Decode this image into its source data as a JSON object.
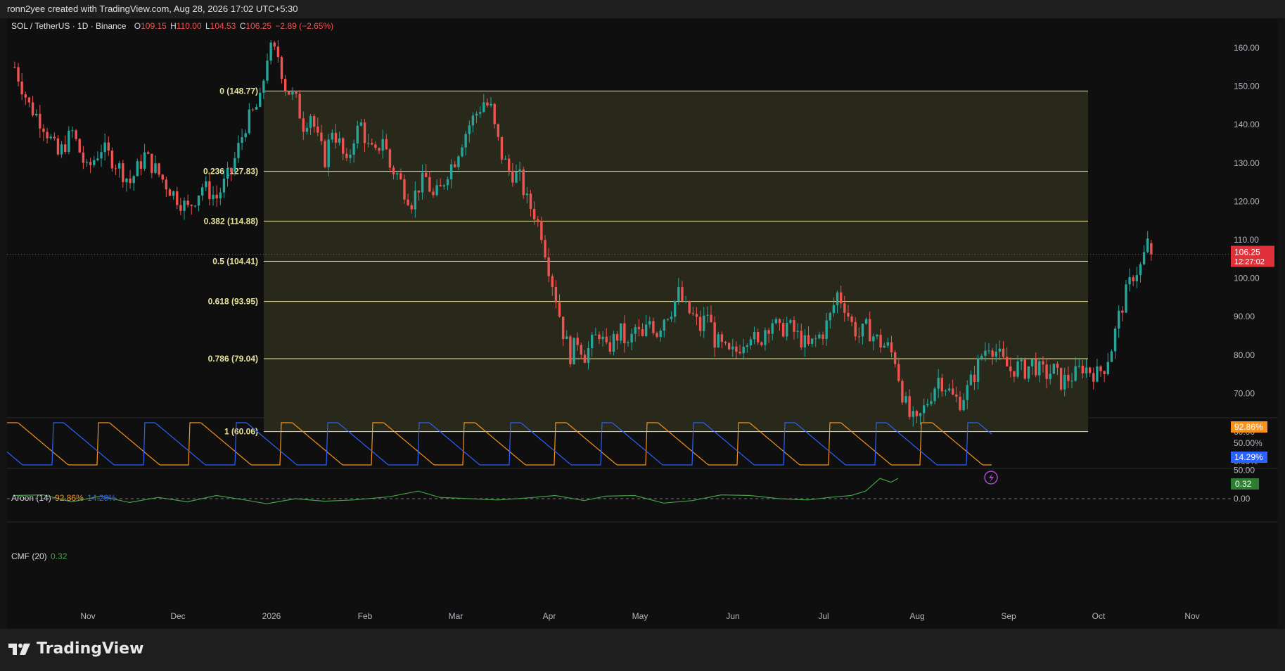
{
  "header": {
    "attribution": "ronn2yee created with TradingView.com, Aug 28, 2026 17:02 UTC+5:30"
  },
  "legend": {
    "symbol": "SOL / TetherUS · 1D · Binance",
    "o_label": "O",
    "o": "109.15",
    "h_label": "H",
    "h": "110.00",
    "l_label": "L",
    "l": "104.53",
    "c_label": "C",
    "c": "106.25",
    "change": "−2.89 (−2.65%)"
  },
  "price_tag": {
    "value": "106.25",
    "countdown": "12:27:02"
  },
  "aroon": {
    "label": "Aroon (14)",
    "up": "92.86%",
    "down": "14.29%"
  },
  "cmf": {
    "label": "CMF (20)",
    "value": "0.32"
  },
  "brand": {
    "name": "TradingView"
  },
  "colors": {
    "up": "#26a69a",
    "down": "#ef5350",
    "fib_line": "#e9e29a",
    "fib_fill": "#2a2a1c",
    "aroon_up": "#f7931a",
    "aroon_down": "#2962ff",
    "cmf": "#43a047",
    "price_tag": "#e0303a"
  },
  "chart_data": {
    "type": "candlestick",
    "symbol": "SOL / TetherUS",
    "interval": "1D",
    "exchange": "Binance",
    "price_axis": {
      "range": [
        43,
        165
      ],
      "ticks": [
        "50.00",
        "60.00",
        "70.00",
        "80.00",
        "90.00",
        "100.00",
        "110.00",
        "120.00",
        "130.00",
        "140.00",
        "150.00",
        "160.00"
      ]
    },
    "x_labels": [
      "Nov",
      "Dec",
      "2026",
      "Feb",
      "Mar",
      "Apr",
      "May",
      "Jun",
      "Jul",
      "Aug",
      "Sep",
      "Oct",
      "Nov"
    ],
    "fibonacci": [
      {
        "ratio": "0",
        "price": 148.77,
        "label": "0 (148.77)"
      },
      {
        "ratio": "0.236",
        "price": 127.83,
        "label": "0.236 (127.83)"
      },
      {
        "ratio": "0.382",
        "price": 114.88,
        "label": "0.382 (114.88)"
      },
      {
        "ratio": "0.5",
        "price": 104.41,
        "label": "0.5 (104.41)"
      },
      {
        "ratio": "0.618",
        "price": 93.95,
        "label": "0.618 (93.95)"
      },
      {
        "ratio": "0.786",
        "price": 79.04,
        "label": "0.786 (79.04)"
      },
      {
        "ratio": "1",
        "price": 60.06,
        "label": "1 (60.06)"
      }
    ],
    "price_path": [
      [
        0,
        160
      ],
      [
        3,
        158
      ],
      [
        5,
        150
      ],
      [
        8,
        146
      ],
      [
        10,
        140
      ],
      [
        12,
        143
      ],
      [
        14,
        136
      ],
      [
        16,
        131
      ],
      [
        18,
        139
      ],
      [
        20,
        135
      ],
      [
        22,
        129
      ],
      [
        24,
        137
      ],
      [
        26,
        140
      ],
      [
        28,
        134
      ],
      [
        30,
        132
      ],
      [
        32,
        137
      ],
      [
        34,
        129
      ],
      [
        36,
        127
      ],
      [
        38,
        123
      ],
      [
        40,
        120
      ],
      [
        42,
        124
      ],
      [
        44,
        126
      ],
      [
        46,
        121
      ],
      [
        48,
        123
      ],
      [
        50,
        128
      ],
      [
        52,
        131
      ],
      [
        54,
        136
      ],
      [
        56,
        140
      ],
      [
        58,
        143
      ],
      [
        60,
        146
      ],
      [
        62,
        144
      ],
      [
        63,
        139
      ],
      [
        65,
        132
      ],
      [
        67,
        128
      ],
      [
        70,
        126
      ],
      [
        72,
        120
      ],
      [
        74,
        117
      ],
      [
        76,
        112
      ],
      [
        78,
        103
      ],
      [
        80,
        95
      ],
      [
        82,
        86
      ],
      [
        84,
        80
      ],
      [
        86,
        84
      ],
      [
        88,
        80
      ],
      [
        90,
        83
      ],
      [
        92,
        86
      ],
      [
        94,
        81
      ],
      [
        96,
        84
      ],
      [
        98,
        86
      ],
      [
        100,
        82
      ],
      [
        102,
        87
      ],
      [
        104,
        84
      ],
      [
        106,
        89
      ],
      [
        108,
        86
      ],
      [
        110,
        90
      ],
      [
        112,
        92
      ],
      [
        114,
        96
      ],
      [
        116,
        92
      ],
      [
        118,
        90
      ],
      [
        120,
        87
      ],
      [
        122,
        91
      ],
      [
        124,
        84
      ],
      [
        126,
        82
      ],
      [
        128,
        80
      ],
      [
        130,
        81
      ],
      [
        132,
        84
      ],
      [
        134,
        86
      ],
      [
        136,
        82
      ],
      [
        138,
        87
      ],
      [
        140,
        89
      ],
      [
        142,
        86
      ],
      [
        144,
        88
      ],
      [
        146,
        86
      ],
      [
        148,
        84
      ],
      [
        150,
        82
      ],
      [
        152,
        84
      ],
      [
        154,
        86
      ],
      [
        156,
        90
      ],
      [
        158,
        96
      ],
      [
        160,
        93
      ],
      [
        162,
        88
      ],
      [
        164,
        85
      ],
      [
        166,
        87
      ],
      [
        168,
        85
      ],
      [
        170,
        83
      ],
      [
        172,
        82
      ],
      [
        174,
        79
      ],
      [
        176,
        70
      ],
      [
        178,
        64
      ],
      [
        180,
        62
      ],
      [
        182,
        66
      ],
      [
        184,
        70
      ],
      [
        186,
        74
      ],
      [
        188,
        72
      ],
      [
        190,
        69
      ],
      [
        192,
        68
      ],
      [
        194,
        71
      ],
      [
        196,
        75
      ],
      [
        198,
        80
      ],
      [
        200,
        83
      ],
      [
        202,
        81
      ],
      [
        204,
        78
      ],
      [
        206,
        76
      ],
      [
        208,
        77
      ],
      [
        210,
        76
      ],
      [
        212,
        78
      ],
      [
        214,
        76
      ],
      [
        216,
        75
      ],
      [
        218,
        76
      ],
      [
        220,
        73
      ],
      [
        222,
        74
      ],
      [
        224,
        75
      ],
      [
        226,
        77
      ],
      [
        228,
        76
      ],
      [
        230,
        75
      ],
      [
        232,
        77
      ],
      [
        234,
        82
      ],
      [
        236,
        90
      ],
      [
        238,
        96
      ],
      [
        240,
        101
      ],
      [
        242,
        103
      ],
      [
        244,
        109
      ],
      [
        245,
        106.25
      ]
    ],
    "aroon": {
      "label": "Aroon (14)",
      "up_latest": 92.86,
      "down_latest": 14.29,
      "ticks": [
        "50.00%",
        "0.00%"
      ]
    },
    "cmf": {
      "label": "CMF (20)",
      "latest": 0.32,
      "ticks": [
        "0.00"
      ],
      "path": [
        [
          0,
          0.05
        ],
        [
          8,
          0.06
        ],
        [
          16,
          -0.05
        ],
        [
          24,
          0.04
        ],
        [
          32,
          -0.06
        ],
        [
          40,
          0.02
        ],
        [
          48,
          -0.05
        ],
        [
          56,
          0.05
        ],
        [
          64,
          -0.02
        ],
        [
          70,
          -0.08
        ],
        [
          78,
          0.0
        ],
        [
          86,
          -0.04
        ],
        [
          94,
          -0.02
        ],
        [
          104,
          0.03
        ],
        [
          112,
          0.12
        ],
        [
          118,
          0.02
        ],
        [
          126,
          0.0
        ],
        [
          134,
          -0.02
        ],
        [
          142,
          0.01
        ],
        [
          150,
          0.05
        ],
        [
          158,
          -0.03
        ],
        [
          164,
          0.04
        ],
        [
          172,
          0.05
        ],
        [
          180,
          -0.07
        ],
        [
          188,
          -0.03
        ],
        [
          196,
          0.06
        ],
        [
          204,
          0.05
        ],
        [
          212,
          0.0
        ],
        [
          220,
          -0.02
        ],
        [
          226,
          0.02
        ],
        [
          232,
          0.05
        ],
        [
          236,
          0.12
        ],
        [
          240,
          0.32
        ],
        [
          243,
          0.26
        ],
        [
          245,
          0.32
        ]
      ]
    }
  }
}
